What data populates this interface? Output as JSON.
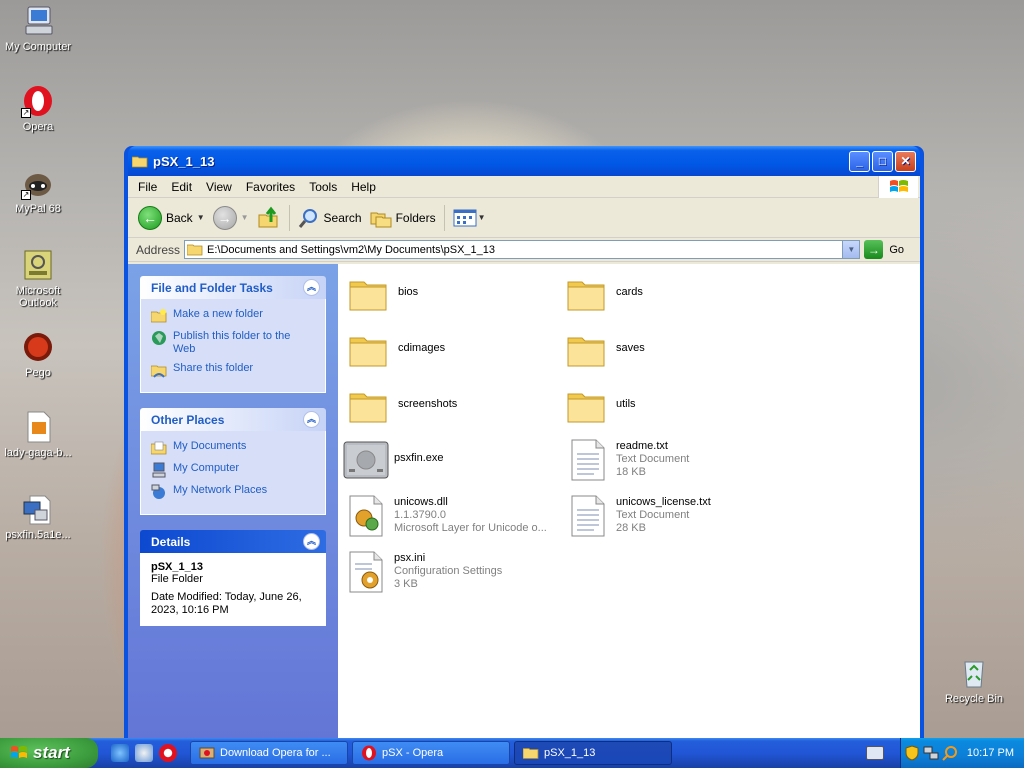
{
  "desktop": {
    "icons": [
      {
        "label": "My Computer"
      },
      {
        "label": "Opera"
      },
      {
        "label": "MyPal 68"
      },
      {
        "label": "Microsoft Outlook"
      },
      {
        "label": "Pego"
      },
      {
        "label": "lady-gaga-b..."
      },
      {
        "label": "psxfin.5a1e..."
      },
      {
        "label": "Recycle Bin"
      }
    ]
  },
  "window": {
    "title": "pSX_1_13",
    "menu": [
      "File",
      "Edit",
      "View",
      "Favorites",
      "Tools",
      "Help"
    ],
    "toolbar": {
      "back": "Back",
      "search": "Search",
      "folders": "Folders"
    },
    "address": {
      "label": "Address",
      "value": "E:\\Documents and Settings\\vm2\\My Documents\\pSX_1_13",
      "go": "Go"
    },
    "taskpane": {
      "file_tasks": {
        "title": "File and Folder Tasks",
        "items": [
          "Make a new folder",
          "Publish this folder to the Web",
          "Share this folder"
        ]
      },
      "other_places": {
        "title": "Other Places",
        "items": [
          "My Documents",
          "My Computer",
          "My Network Places"
        ]
      },
      "details": {
        "title": "Details",
        "name": "pSX_1_13",
        "type": "File Folder",
        "modified": "Date Modified: Today, June 26, 2023, 10:16 PM"
      }
    },
    "files": [
      {
        "name": "bios",
        "kind": "folder"
      },
      {
        "name": "cards",
        "kind": "folder"
      },
      {
        "name": "cdimages",
        "kind": "folder"
      },
      {
        "name": "saves",
        "kind": "folder"
      },
      {
        "name": "screenshots",
        "kind": "folder"
      },
      {
        "name": "utils",
        "kind": "folder"
      },
      {
        "name": "psxfin.exe",
        "kind": "exe"
      },
      {
        "name": "readme.txt",
        "line2": "Text Document",
        "line3": "18 KB",
        "kind": "txt"
      },
      {
        "name": "unicows.dll",
        "line2": "1.1.3790.0",
        "line3": "Microsoft Layer for Unicode o...",
        "kind": "dll"
      },
      {
        "name": "unicows_license.txt",
        "line2": "Text Document",
        "line3": "28 KB",
        "kind": "txt"
      },
      {
        "name": "psx.ini",
        "line2": "Configuration Settings",
        "line3": "3 KB",
        "kind": "ini"
      }
    ]
  },
  "taskbar": {
    "start": "start",
    "buttons": [
      {
        "label": "Download Opera for ..."
      },
      {
        "label": "pSX - Opera"
      },
      {
        "label": "pSX_1_13"
      }
    ],
    "clock": "10:17 PM"
  }
}
